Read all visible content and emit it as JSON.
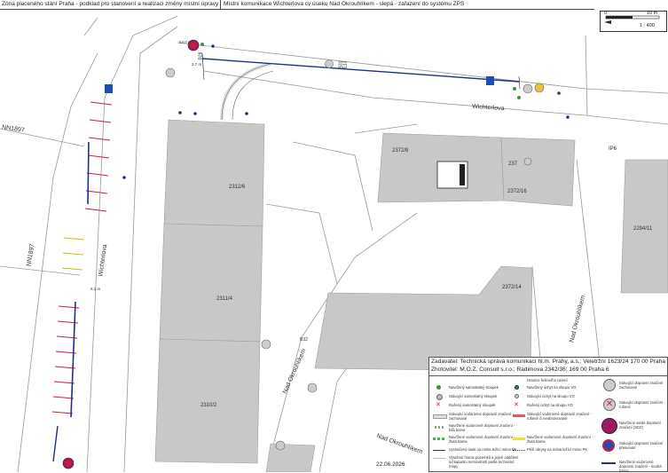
{
  "header": {
    "left_title": "Zóna placeného stání Praha - podklad pro stanovení a realizaci změny místní úpravy",
    "right_title": "Místní komunikace Wichterlova cv úseku Nad Okrouhlíkem - slepá - zařazení do systému ZPS"
  },
  "scale": {
    "zero": "0",
    "ten": "10 m",
    "ratio": "1 : 400"
  },
  "streets": {
    "wichterlova_top": "Wichterlova",
    "wichterlova_left": "Wichterlova",
    "nad_okrouhlikem_center": "Nad Okrouhlíkem",
    "nad_okrouhlikem_bottom": "Nad Okrouhlíkem",
    "nad_okrouhlikem_right": "Nad Okrouhlíkem"
  },
  "parcels": {
    "nn1897_top": "NN1897",
    "nn1897_left": "NN1897",
    "b2312_6": "2312/6",
    "b2311_4": "2311/4",
    "b2310_2": "2310/2",
    "b2372_8": "2372/8",
    "b2372_16": "2372/16",
    "b2372_14": "2372/14",
    "b2294_11": "2294/11",
    "b2372_short": "237"
  },
  "labels": {
    "ip6": "IP6",
    "b28": "B28",
    "b32": "B32",
    "b31": "B31",
    "e13": "E13",
    "dim_top": "53,0 m",
    "dim_left": "6,1 m",
    "dim_right": "2,7 m"
  },
  "legend": {
    "client": "Zadavatel: Technická správa komunikací hl.m. Prahy, a.s.; Veletržní 1623/24 170 00 Praha",
    "contractor": "Zhotovitel: M.O.Z. Consult s.r.o.; Radimova 2342/36; 169 00 Praha 6",
    "items": [
      "Hranice řešeného území",
      "Navržený samostatný sloupek",
      "Stávající samostatný sloupek",
      "Rušený samostatný sloupek",
      "Navržený úchyt na sloupu VO",
      "Stávající úchyt na sloupu VO",
      "Rušený úchyt na sloupu VO",
      "Stávající vodorovné dopravní značení - zachované",
      "Stávající vodorovné dopravní značení - rušené či neobnovované",
      "Navržené vodorovné dopravní značení - bílá barva",
      "Navržené vodorovné dopravní značení - žlutá barva",
      "Vyznačený úsek na místa ležící mimo PK",
      "Pěší obrysy na místa ležící mimo PK",
      "Výtažení hranic pozemků a jejich oddělení od katastru nemovitostí podle technické mapy",
      "Stávající dopravní značení zachované",
      "Stávající dopravní značení - rušené",
      "Navržené svislé dopravní značení (SDZ)",
      "Stávající dopravní značení přesunuté",
      "Navržené vodorovné dopravní značení - modrá barva"
    ]
  },
  "date": "22.06.2026",
  "colors": {
    "building": "#c8c8c8",
    "road_line": "#999999",
    "blue_line": "#1f2f8a",
    "red_sign": "#d21a3c",
    "magenta_sign": "#a01a66",
    "green_dot": "#2a9a3a"
  }
}
